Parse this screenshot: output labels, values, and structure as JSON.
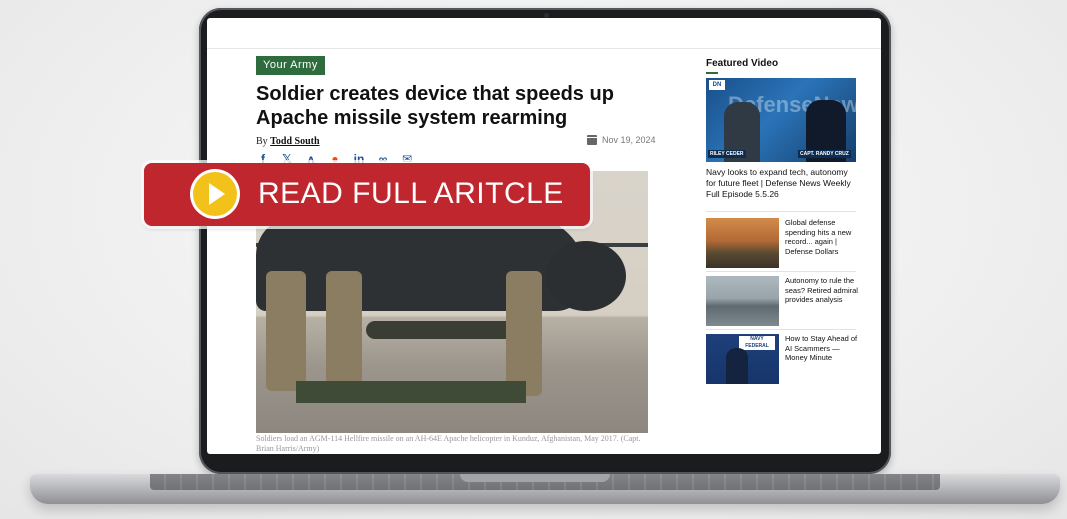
{
  "article": {
    "section_badge": "Your Army",
    "headline": "Soldier creates device that speeds up Apache missile system rearming",
    "byline_prefix": "By",
    "author": "Todd South",
    "date": "Nov 19, 2024",
    "share_icons": [
      "facebook-icon",
      "x-icon",
      "bluesky-icon",
      "reddit-icon",
      "linkedin-icon",
      "link-icon",
      "email-icon"
    ],
    "caption": "Soldiers load an AGM-114 Hellfire missile on an AH-64E Apache helicopter in Kunduz, Afghanistan, May 2017. (Capt. Brian Harris/Army)"
  },
  "sidebar": {
    "featured_title": "Featured Video",
    "video": {
      "logo": "DN",
      "brand_word": "DefenseNews",
      "guest1_name": "RILEY CEDER",
      "guest2_name": "CAPT. RANDY CRUZ",
      "title": "Navy looks to expand tech, autonomy for future fleet | Defense News Weekly Full Episode 5.5.26"
    },
    "items": [
      {
        "title": "Global defense spending hits a new record... again | Defense Dollars"
      },
      {
        "title": "Autonomy to rule the seas? Retired admiral provides analysis"
      },
      {
        "title": "How to Stay Ahead of AI Scammers — Money Minute",
        "logo": "NAVY FEDERAL"
      }
    ]
  },
  "overlay": {
    "label": "READ FULL ARITCLE",
    "color": "#c0262d",
    "icon": "play-icon"
  },
  "colors": {
    "badge": "#2e6b3d",
    "share": "#1d4f91"
  }
}
